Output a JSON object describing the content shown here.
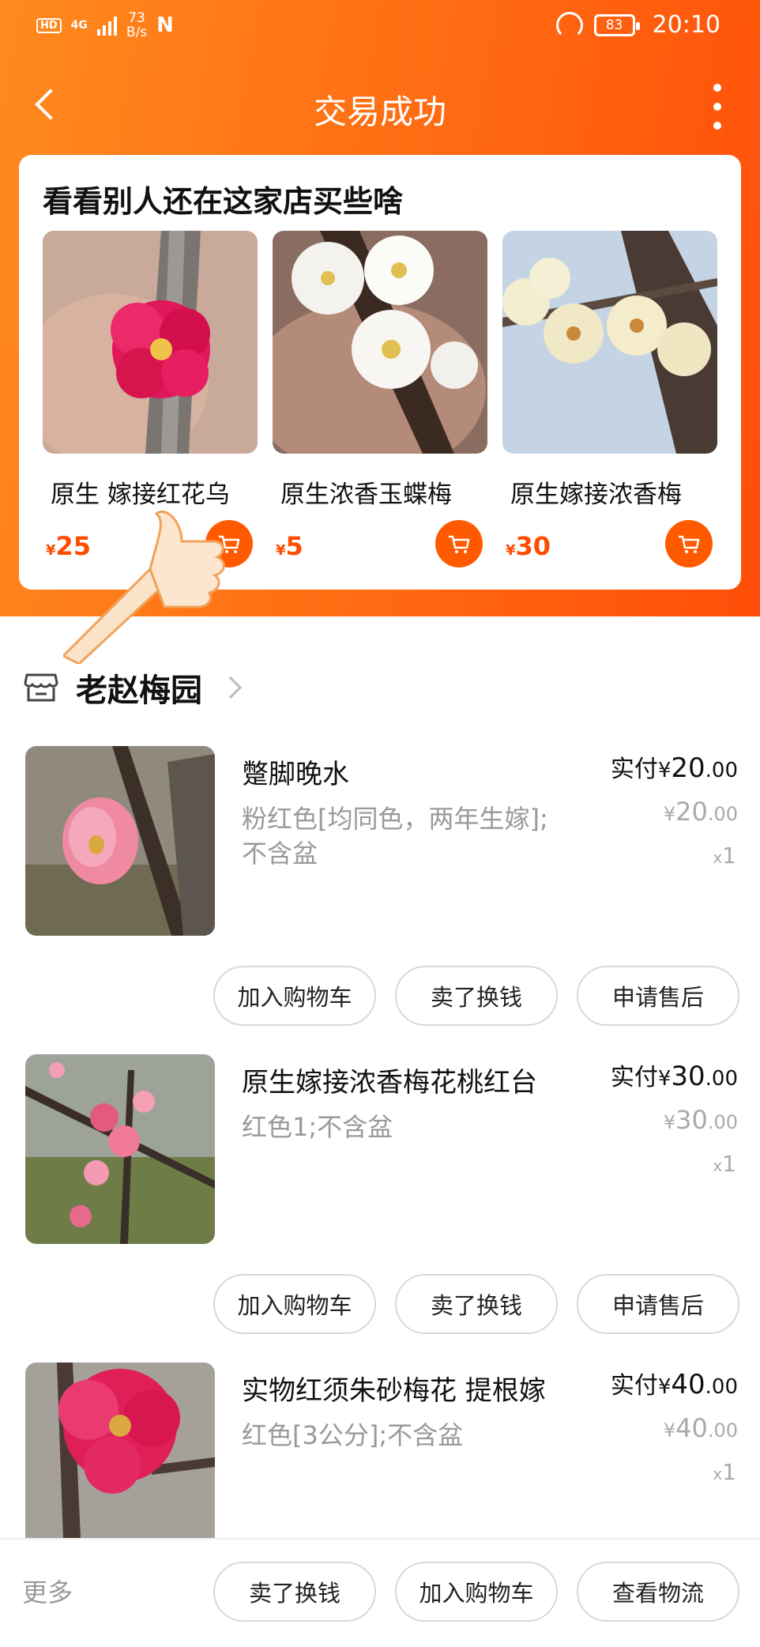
{
  "status_bar": {
    "hd": "HD",
    "network": "4G",
    "speed_value": "73",
    "speed_unit": "B/s",
    "nfc": "N",
    "battery": "83",
    "time": "20:10"
  },
  "header": {
    "title": "交易成功"
  },
  "recommend": {
    "title": "看看别人还在这家店买些啥",
    "items": [
      {
        "name": "原生 嫁接红花乌",
        "currency": "¥",
        "price": "25"
      },
      {
        "name": "原生浓香玉蝶梅",
        "currency": "¥",
        "price": "5"
      },
      {
        "name": "原生嫁接浓香梅",
        "currency": "¥",
        "price": "30"
      }
    ]
  },
  "shop": {
    "name": "老赵梅园"
  },
  "orders": [
    {
      "name": "蹩脚晚水",
      "spec": "粉红色[均同色，两年生嫁];不含盆",
      "paid_label": "实付",
      "currency": "¥",
      "paid_int": "20",
      "paid_dec": ".00",
      "price_int": "20",
      "price_dec": ".00",
      "qty_x": "x",
      "qty": "1",
      "buttons": [
        "加入购物车",
        "卖了换钱",
        "申请售后"
      ]
    },
    {
      "name": "原生嫁接浓香梅花桃红台",
      "spec": "红色1;不含盆",
      "paid_label": "实付",
      "currency": "¥",
      "paid_int": "30",
      "paid_dec": ".00",
      "price_int": "30",
      "price_dec": ".00",
      "qty_x": "x",
      "qty": "1",
      "buttons": [
        "加入购物车",
        "卖了换钱",
        "申请售后"
      ]
    },
    {
      "name": "实物红须朱砂梅花 提根嫁",
      "spec": "红色[3公分];不含盆",
      "paid_label": "实付",
      "currency": "¥",
      "paid_int": "40",
      "paid_dec": ".00",
      "price_int": "40",
      "price_dec": ".00",
      "qty_x": "x",
      "qty": "1"
    }
  ],
  "bottom_bar": {
    "more": "更多",
    "buttons": [
      "卖了换钱",
      "加入购物车",
      "查看物流"
    ]
  },
  "colors": {
    "header_orange": "#ff6a12",
    "price_orange": "#ff4b00"
  }
}
